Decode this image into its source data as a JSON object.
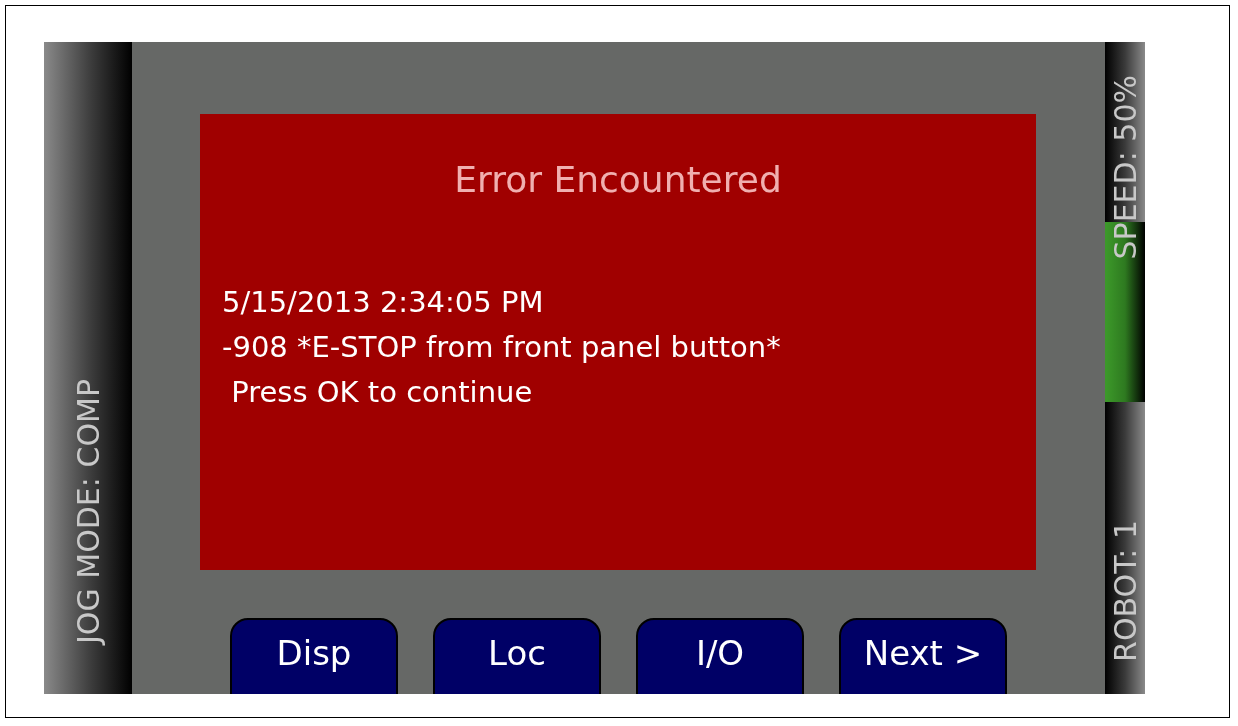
{
  "status_left": {
    "text": "JOG MODE: COMP"
  },
  "error_dialog": {
    "title": "Error Encountered",
    "lines": [
      "5/15/2013 2:34:05 PM",
      "-908 *E-STOP from front panel button*",
      " Press OK to continue"
    ]
  },
  "soft_keys": [
    {
      "label": "Disp"
    },
    {
      "label": "Loc"
    },
    {
      "label": "I/O"
    },
    {
      "label": "Next >"
    }
  ],
  "status_right": [
    {
      "text": "SPEED: 50%",
      "highlighted": true
    },
    {
      "text": "ROBOT: 1",
      "highlighted": false
    }
  ]
}
